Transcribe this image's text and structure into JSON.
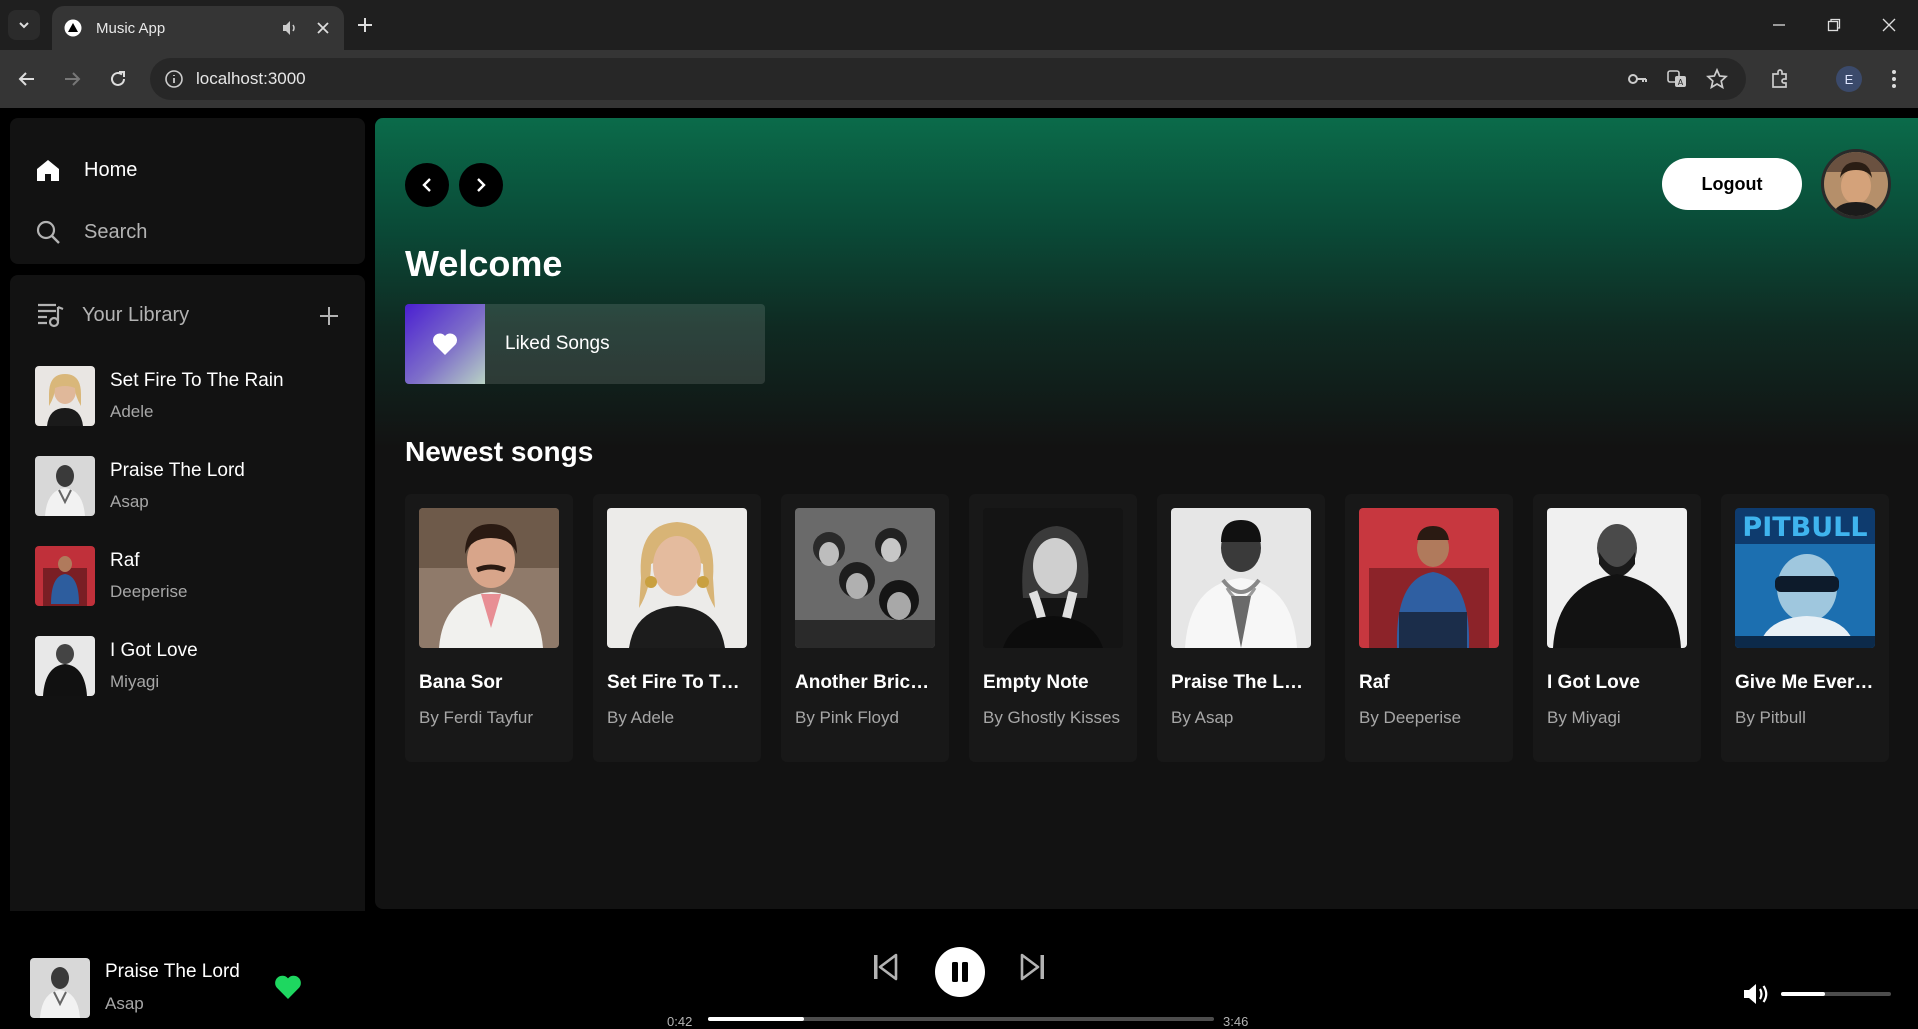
{
  "browser": {
    "tab_title": "Music App",
    "url": "localhost:3000",
    "profile_initial": "E"
  },
  "sidebar": {
    "nav": [
      {
        "label": "Home",
        "icon": "home-icon"
      },
      {
        "label": "Search",
        "icon": "search-icon"
      }
    ],
    "library_label": "Your Library",
    "library_items": [
      {
        "title": "Set Fire To The Rain",
        "artist": "Adele"
      },
      {
        "title": "Praise The Lord",
        "artist": "Asap"
      },
      {
        "title": "Raf",
        "artist": "Deeperise"
      },
      {
        "title": "I Got Love",
        "artist": "Miyagi"
      }
    ]
  },
  "main": {
    "logout_label": "Logout",
    "welcome": "Welcome",
    "liked_songs_label": "Liked Songs",
    "newest_title": "Newest songs",
    "cards": [
      {
        "title": "Bana Sor",
        "artist": "By Ferdi Tayfur"
      },
      {
        "title": "Set Fire To The Rain",
        "artist": "By Adele"
      },
      {
        "title": "Another Brick in the Wall",
        "artist": "By Pink Floyd"
      },
      {
        "title": "Empty Note",
        "artist": "By Ghostly Kisses"
      },
      {
        "title": "Praise The Lord",
        "artist": "By Asap"
      },
      {
        "title": "Raf",
        "artist": "By Deeperise"
      },
      {
        "title": "I Got Love",
        "artist": "By Miyagi"
      },
      {
        "title": "Give Me Everything",
        "artist": "By Pitbull"
      }
    ]
  },
  "player": {
    "title": "Praise The Lord",
    "artist": "Asap",
    "elapsed": "0:42",
    "duration": "3:46",
    "progress": 0.19,
    "volume": 0.4,
    "liked": true
  },
  "colors": {
    "accent": "#1ed760",
    "gradient_top": "#0b6b4a"
  }
}
